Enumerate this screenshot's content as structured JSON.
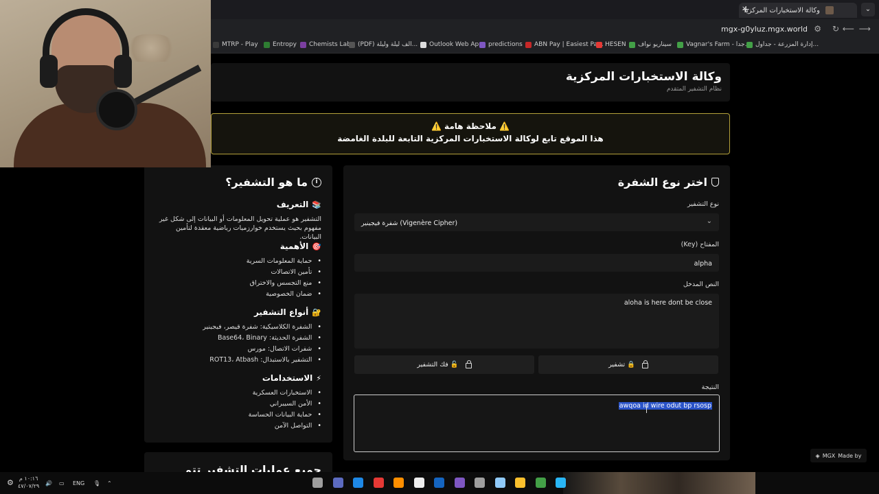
{
  "browser": {
    "tab_title": "وكالة الاستخبارات المركزية - نظام التشفير",
    "url": "mgx-g0yluz.mgx.world",
    "bookmarks": [
      {
        "label": "MTRP - Play",
        "color": "#3a3a3a"
      },
      {
        "label": "Entropy",
        "color": "#2e7d32"
      },
      {
        "label": "Chemists Lab",
        "color": "#7b3fa0"
      },
      {
        "label": "(PDF) الف ليلة وليلة...",
        "color": "#555555"
      },
      {
        "label": "Outlook Web App",
        "color": "#dddddd"
      },
      {
        "label": "predictions",
        "color": "#7e57c2"
      },
      {
        "label": "ABN Pay | Easiest Pa...",
        "color": "#c62828"
      },
      {
        "label": "HESEN",
        "color": "#e53935"
      },
      {
        "label": "سيناريو نواف",
        "color": "#43a047"
      },
      {
        "label": "Vagnar's Farm - جدا...",
        "color": "#43a047"
      },
      {
        "label": "إدارة المزرعة - جداول...",
        "color": "#43a047"
      }
    ]
  },
  "header": {
    "title": "وكالة الاستخبارات المركزية",
    "subtitle": "نظام التشفير المتقدم"
  },
  "notice": {
    "title": "⚠️ ملاحظة هامة ⚠️",
    "text": "هذا الموقع تابع لوكالة الاستخبارات المركزية التابعة للبلدة الغامضة"
  },
  "info": {
    "heading": "ما هو التشفير؟",
    "definition": {
      "title": "التعريف",
      "emoji": "📚",
      "text": "التشفير هو عملية تحويل المعلومات أو البيانات إلى شكل غير مفهوم بحيث يستخدم خوارزميات رياضية معقدة لتأمين البيانات."
    },
    "importance": {
      "title": "الأهمية",
      "emoji": "🎯",
      "items": [
        "حماية المعلومات السرية",
        "تأمين الاتصالات",
        "منع التجسس والاختراق",
        "ضمان الخصوصية"
      ]
    },
    "types": {
      "title": "أنواع التشفير",
      "emoji": "🔐",
      "items": [
        "الشفرة الكلاسيكية: شفرة قيصر، فيجينير",
        "الشفرة الحديثة: Base64، Binary",
        "شفرات الاتصال: مورس",
        "التشفير بالاستبدال: ROT13، Atbash"
      ]
    },
    "uses": {
      "title": "الاستخدامات",
      "emoji": "⚡",
      "items": [
        "الاستخبارات العسكرية",
        "الأمن السيبراني",
        "حماية البيانات الحساسة",
        "التواصل الآمن"
      ]
    },
    "next_heading": "جميع عمليات التشفير تتم داخل",
    "next_emoji": "🔒"
  },
  "cipher": {
    "heading": "اختر نوع الشفرة",
    "type_label": "نوع التشفير",
    "type_value": "شفرة فيجينير (Vigenère Cipher)",
    "key_label": "المفتاح (Key)",
    "key_value": "alpha",
    "input_label": "النص المدخل",
    "input_value": "aloha is here dont be close",
    "encrypt_label": "🔒 تشفير",
    "decrypt_label": "🔓 فك التشفير",
    "result_label": "النتيجة",
    "result_value": "awqoa id wire odut bp rsosp"
  },
  "badge": {
    "label": "Made by",
    "brand": "MGX"
  },
  "taskbar": {
    "time": "١٠:١٦ م",
    "date": "٤٧/٠٧/٢٩",
    "lang": "ENG",
    "apps": [
      {
        "name": "app-1",
        "color": "#9e9e9e"
      },
      {
        "name": "app-2",
        "color": "#5c6bc0"
      },
      {
        "name": "edge",
        "color": "#1e88e5"
      },
      {
        "name": "app-4",
        "color": "#e53935"
      },
      {
        "name": "app-5",
        "color": "#ff8f00"
      },
      {
        "name": "app-6",
        "color": "#eeeeee"
      },
      {
        "name": "steam",
        "color": "#1565c0"
      },
      {
        "name": "discord",
        "color": "#7e57c2"
      },
      {
        "name": "app-9",
        "color": "#9e9e9e"
      },
      {
        "name": "app-10",
        "color": "#90caf9"
      },
      {
        "name": "explorer",
        "color": "#fbc02d"
      },
      {
        "name": "chrome",
        "color": "#43a047"
      },
      {
        "name": "windows",
        "color": "#29b6f6"
      }
    ]
  }
}
